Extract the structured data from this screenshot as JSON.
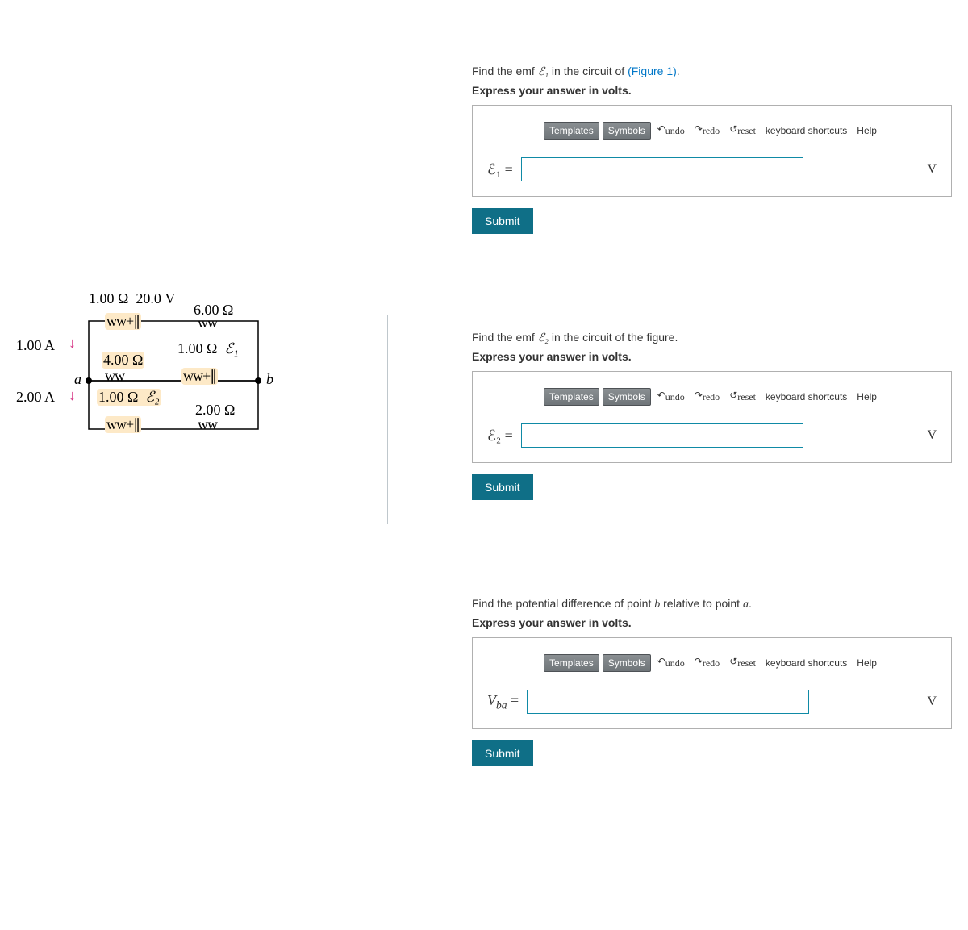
{
  "figure": {
    "top_r1": "1.00 Ω",
    "top_v": "20.0 V",
    "r_6": "6.00 Ω",
    "i_1": "1.00 A",
    "r_4": "4.00 Ω",
    "r_mid_1": "1.00 Ω",
    "emf1": "ℰ₁",
    "node_a": "a",
    "node_b": "b",
    "i_2": "2.00 A",
    "r_bot_1": "1.00 Ω",
    "emf2": "ℰ₂",
    "r_2": "2.00 Ω"
  },
  "toolbar": {
    "templates": "Templates",
    "symbols": "Symbols",
    "undo": "undo",
    "redo": "redo",
    "reset": "reset",
    "kb": "keyboard shortcuts",
    "help": "Help"
  },
  "parts": [
    {
      "prompt_pre": "Find the emf ",
      "prompt_var": "ℰ₁",
      "prompt_post": " in the circuit of ",
      "fig_ref": "(Figure 1)",
      "prompt_end": ".",
      "instr": "Express your answer in volts.",
      "lhs": "ℰ₁ =",
      "unit": "V",
      "submit": "Submit"
    },
    {
      "prompt_pre": "Find the emf ",
      "prompt_var": "ℰ₂",
      "prompt_post": " in the circuit of the figure.",
      "fig_ref": "",
      "prompt_end": "",
      "instr": "Express your answer in volts.",
      "lhs": "ℰ₂ =",
      "unit": "V",
      "submit": "Submit"
    },
    {
      "prompt_full": "Find the potential difference of point b relative to point a.",
      "instr": "Express your answer in volts.",
      "lhs": "Vba =",
      "lhs_html_sub": "ba",
      "lhs_pre": "V",
      "unit": "V",
      "submit": "Submit"
    }
  ]
}
